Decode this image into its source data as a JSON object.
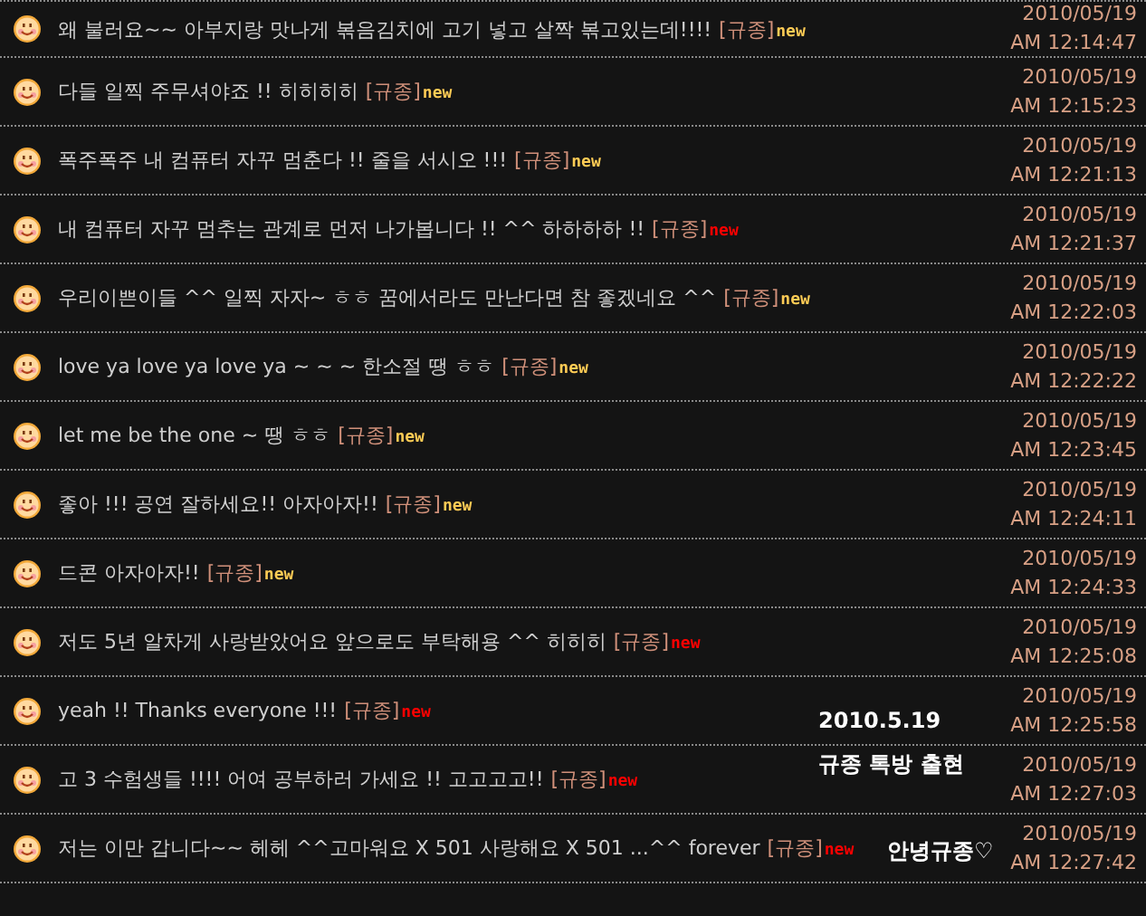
{
  "messages": [
    {
      "text": "왜 불러요~~ 아부지랑 맛나게 볶음김치에 고기 넣고 살짝 볶고있는데!!!!",
      "tag": "[규종]",
      "badge": "new",
      "color": "#ffcc55",
      "date": "2010/05/19",
      "time": "AM 12:14:47"
    },
    {
      "text": "다들 일찍 주무셔야죠 !! 히히히히",
      "tag": "[규종]",
      "badge": "new",
      "color": "#ffcc55",
      "date": "2010/05/19",
      "time": "AM 12:15:23"
    },
    {
      "text": "폭주폭주 내 컴퓨터 자꾸 멈춘다 !! 줄을 서시오 !!!",
      "tag": "[규종]",
      "badge": "new",
      "color": "#ffcc55",
      "date": "2010/05/19",
      "time": "AM 12:21:13"
    },
    {
      "text": "내 컴퓨터 자꾸 멈추는 관계로 먼저 나가봅니다 !! ^^ 하하하하 !!",
      "tag": "[규종]",
      "badge": "new",
      "color": "#ff0000",
      "date": "2010/05/19",
      "time": "AM 12:21:37"
    },
    {
      "text": "우리이쁜이들 ^^ 일찍 자자~ ㅎㅎ 꿈에서라도 만난다면 참 좋겠네요 ^^",
      "tag": "[규종]",
      "badge": "new",
      "color": "#ffcc55",
      "date": "2010/05/19",
      "time": "AM 12:22:03"
    },
    {
      "text": "love ya love ya love ya ~ ~ ~ 한소절 땡 ㅎㅎ",
      "tag": "[규종]",
      "badge": "new",
      "color": "#ffcc55",
      "date": "2010/05/19",
      "time": "AM 12:22:22"
    },
    {
      "text": "let me be the one ~ 땡 ㅎㅎ",
      "tag": "[규종]",
      "badge": "new",
      "color": "#ffcc55",
      "date": "2010/05/19",
      "time": "AM 12:23:45"
    },
    {
      "text": "좋아 !!! 공연 잘하세요!! 아자아자!!",
      "tag": "[규종]",
      "badge": "new",
      "color": "#ffcc55",
      "date": "2010/05/19",
      "time": "AM 12:24:11"
    },
    {
      "text": "드콘 아자아자!!",
      "tag": "[규종]",
      "badge": "new",
      "color": "#ffcc55",
      "date": "2010/05/19",
      "time": "AM 12:24:33"
    },
    {
      "text": "저도 5년 알차게 사랑받았어요 앞으로도 부탁해용 ^^ 히히히",
      "tag": "[규종]",
      "badge": "new",
      "color": "#ff0000",
      "date": "2010/05/19",
      "time": "AM 12:25:08"
    },
    {
      "text": "yeah !! Thanks everyone !!!",
      "tag": "[규종]",
      "badge": "new",
      "color": "#ff0000",
      "date": "2010/05/19",
      "time": "AM 12:25:58"
    },
    {
      "text": "고 3 수험생들 !!!! 어여 공부하러 가세요 !! 고고고고!!",
      "tag": "[규종]",
      "badge": "new",
      "color": "#ff0000",
      "date": "2010/05/19",
      "time": "AM 12:27:03"
    },
    {
      "text": "저는 이만 갑니다~~ 헤헤 ^^고마워요 X 501 사랑해요 X 501 ...^^ forever",
      "tag": "[규종]",
      "badge": "new",
      "color": "#ff0000",
      "date": "2010/05/19",
      "time": "AM 12:27:42"
    }
  ],
  "annotations": [
    "2010.5.19",
    "규종 톡방 출현",
    "안녕규종♡"
  ]
}
